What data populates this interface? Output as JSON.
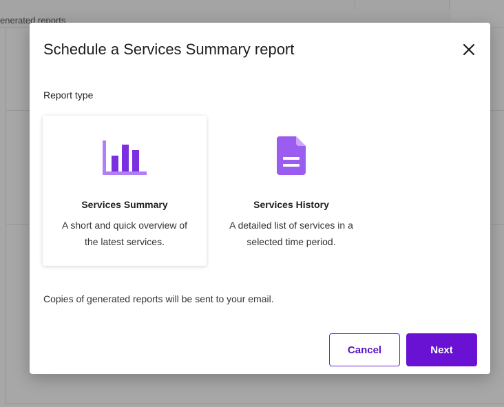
{
  "background": {
    "header_text": "enerated reports"
  },
  "modal": {
    "title": "Schedule a Services Summary report",
    "section_label": "Report type",
    "cards": [
      {
        "title": "Services Summary",
        "desc_line1": "A short and quick overview of",
        "desc_line2": "the latest services.",
        "icon": "bar-chart-icon",
        "selected": true
      },
      {
        "title": "Services History",
        "desc_line1": "A detailed list of services in a",
        "desc_line2": "selected time period.",
        "icon": "document-icon",
        "selected": false
      }
    ],
    "footnote": "Copies of generated reports will be sent to your email.",
    "cancel_label": "Cancel",
    "next_label": "Next"
  },
  "colors": {
    "accent": "#6a12d4",
    "icon_purple": "#7b2fe0",
    "icon_light": "#b07ef5"
  }
}
